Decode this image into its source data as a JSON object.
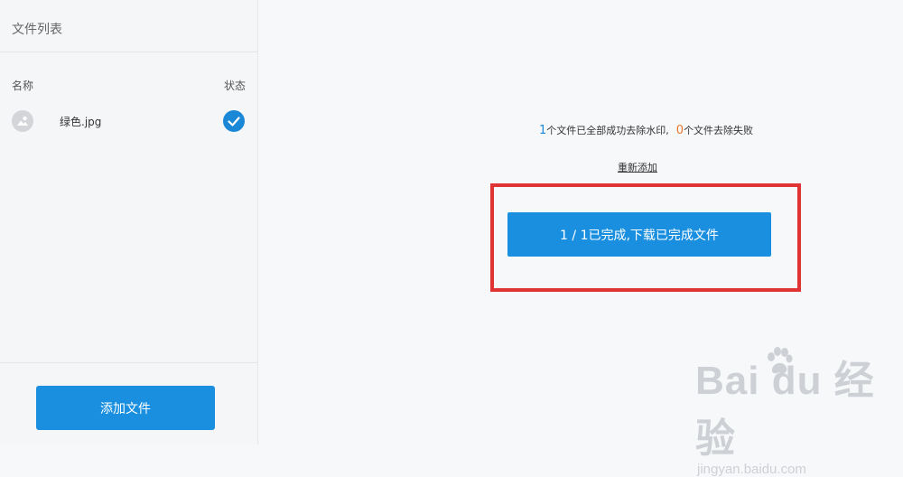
{
  "sidebar": {
    "title": "文件列表",
    "column_name": "名称",
    "column_status": "状态",
    "files": [
      {
        "name": "绿色.jpg",
        "status": "completed"
      }
    ],
    "add_button": "添加文件"
  },
  "main": {
    "success_count": "1",
    "success_text": "个文件已全部成功去除水印,",
    "fail_count": "0",
    "fail_text": "个文件去除失败",
    "readd_link": "重新添加",
    "download_button": "1 / 1已完成,下载已完成文件"
  },
  "watermark": {
    "logo_text": "Bai du 经验",
    "sub_text": "jingyan.baidu.com"
  },
  "colors": {
    "accent": "#1a8fe0",
    "highlight": "#e03434",
    "fail": "#e8762a"
  }
}
